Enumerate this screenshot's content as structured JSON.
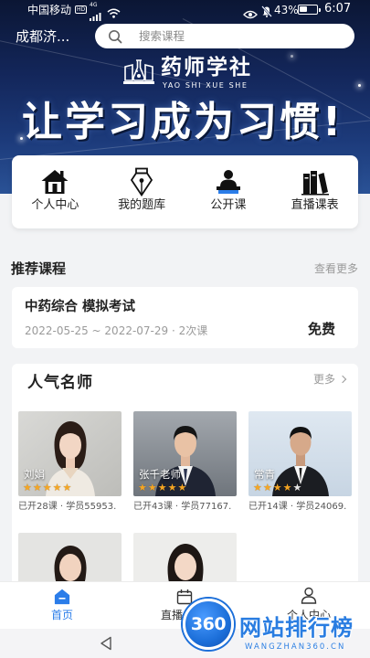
{
  "status_bar": {
    "carrier": "中国移动",
    "hd": "HD",
    "network": "4G",
    "battery": "43%",
    "time": "6:07"
  },
  "header": {
    "location": "成都济...",
    "search_placeholder": "搜索课程"
  },
  "banner": {
    "logo_cn": "药师学社",
    "logo_en": "YAO SHI XUE SHE",
    "slogan": "让学习成为习惯!"
  },
  "quick_menu": [
    {
      "label": "个人中心",
      "icon": "home-icon"
    },
    {
      "label": "我的题库",
      "icon": "pen-nib-icon"
    },
    {
      "label": "公开课",
      "icon": "lecture-icon"
    },
    {
      "label": "直播课表",
      "icon": "books-icon"
    }
  ],
  "recommended": {
    "title": "推荐课程",
    "more": "查看更多",
    "course": {
      "title": "中药综合 模拟考试",
      "meta": "2022-05-25 ~ 2022-07-29 · 2次课",
      "price": "免费"
    }
  },
  "teachers": {
    "title": "人气名师",
    "more": "更多",
    "items": [
      {
        "name": "刘娟",
        "rating": 5,
        "stats": "已开28课 · 学员55953."
      },
      {
        "name": "张千老师",
        "rating": 5,
        "stats": "已开43课 · 学员77167."
      },
      {
        "name": "常青",
        "rating": 4,
        "stats": "已开14课 · 学员24069."
      }
    ]
  },
  "bottom_nav": [
    {
      "label": "首页",
      "icon": "home-icon",
      "active": true
    },
    {
      "label": "直播",
      "icon": "calendar-icon",
      "active": false
    },
    {
      "label": "个人中心",
      "icon": "person-icon",
      "active": false
    }
  ],
  "watermark": {
    "logo": "360",
    "title": "网站排行榜",
    "url": "WANGZHAN360.CN"
  },
  "colors": {
    "accent": "#2b7de9",
    "star": "#f5a623",
    "banner": "#13265a",
    "watermark": "#2a7de1"
  }
}
